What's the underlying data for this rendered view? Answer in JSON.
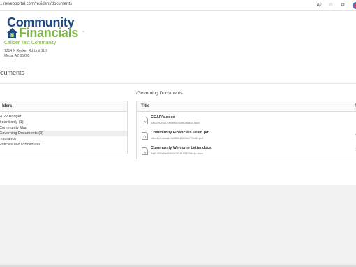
{
  "browser": {
    "url": "...mwebportal.com/resident/documents",
    "icons": [
      "read-aloud-icon",
      "favorite-icon",
      "collections-icon",
      "profile-icon"
    ]
  },
  "header": {
    "logo_line1": "Community",
    "logo_line2": "Financials",
    "logo_tm": "™",
    "community_name": "Caliber Test Community",
    "address_line1": "1314 N Recker Rd Unit 110",
    "address_line2": "Mesa, AZ 85205"
  },
  "main": {
    "title": "ocuments",
    "folders": {
      "header": "lders",
      "items": [
        {
          "label": "2022 Budget",
          "selected": false
        },
        {
          "label": "Board only (1)",
          "selected": false
        },
        {
          "label": "Community Map",
          "selected": false
        },
        {
          "label": "Governing Documents (3)",
          "selected": true
        },
        {
          "label": "Insurance",
          "selected": false
        },
        {
          "label": "Policies and Procedures",
          "selected": false
        }
      ]
    },
    "documents": {
      "heading": "/Governing Documents",
      "col_title": "Title",
      "col_right": "P",
      "rows": [
        {
          "name": "CC&R's.docx",
          "sub": "44c8792b4579b0e6c0f1e8086a4c.docx",
          "mark": ""
        },
        {
          "name": "Community Financials Team.pdf",
          "sub": "c8ee6e2dcbad40c002e10805c770e81.pdf",
          "mark": "4"
        },
        {
          "name": "Community Welcome Letter.docx",
          "sub": "8e61905b9a968d0e3f14153369944c.docx",
          "mark": "1"
        }
      ]
    }
  },
  "colors": {
    "brand_blue": "#1f4a80",
    "brand_green": "#7fb548",
    "selected_row": "#efefef"
  }
}
